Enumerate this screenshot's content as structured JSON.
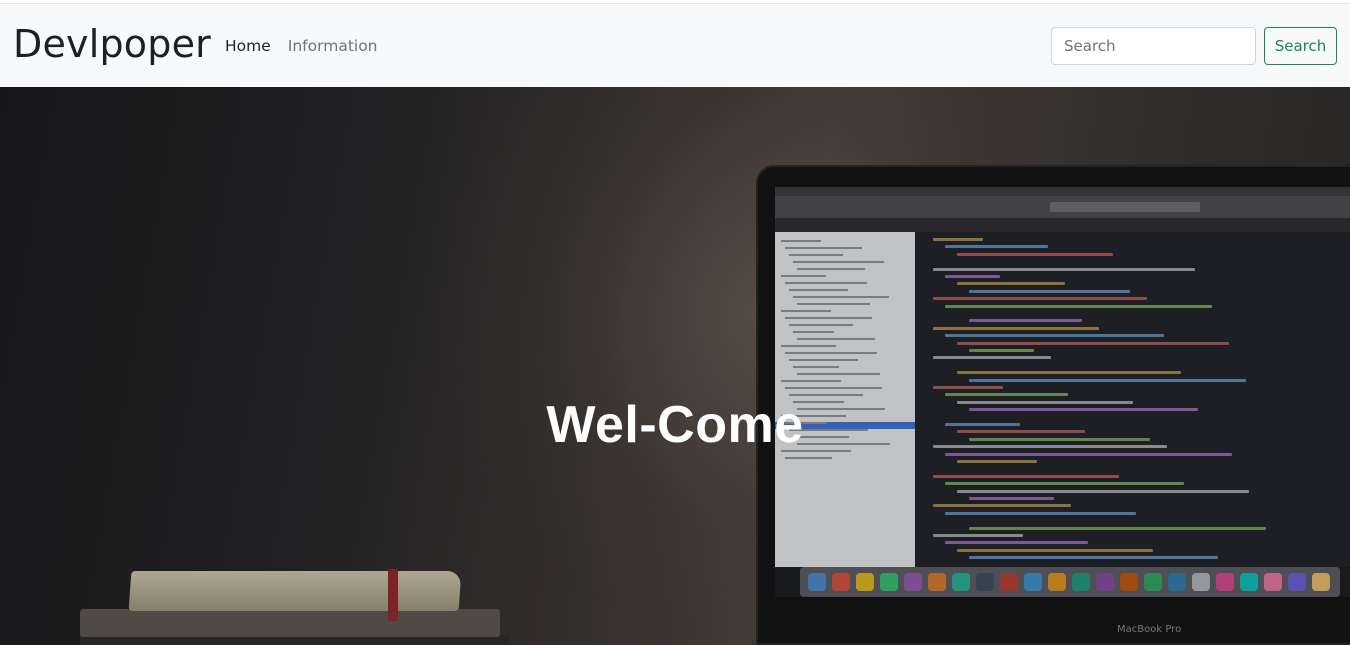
{
  "navbar": {
    "brand": "Devlpoper",
    "links": [
      {
        "label": "Home",
        "active": true
      },
      {
        "label": "Information",
        "active": false
      }
    ],
    "search": {
      "placeholder": "Search",
      "value": ""
    },
    "search_button": "Search"
  },
  "hero": {
    "title": "Wel-Come",
    "background_image": "laptop-with-code-editor-photo",
    "laptop_label": "MacBook Pro"
  },
  "colors": {
    "navbar_bg": "#f8f9fa",
    "search_button": "#198754",
    "hero_title": "#ffffff"
  }
}
